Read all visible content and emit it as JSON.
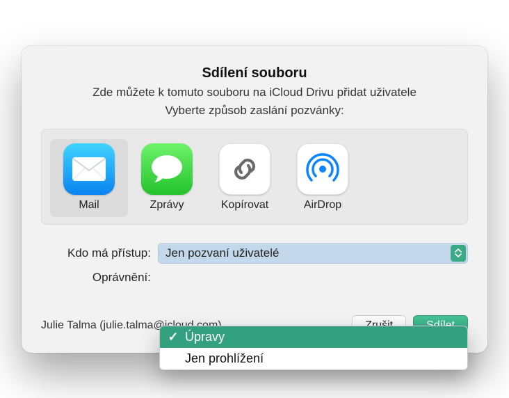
{
  "header": {
    "title": "Sdílení souboru",
    "subtitle": "Zde můžete k tomuto souboru na iCloud Drivu přidat uživatele",
    "prompt": "Vyberte způsob zaslání pozvánky:"
  },
  "methods": {
    "items": [
      {
        "label": "Mail",
        "icon": "mail-icon",
        "selected": true
      },
      {
        "label": "Zprávy",
        "icon": "messages-icon",
        "selected": false
      },
      {
        "label": "Kopírovat",
        "icon": "link-icon",
        "selected": false
      },
      {
        "label": "AirDrop",
        "icon": "airdrop-icon",
        "selected": false
      }
    ]
  },
  "access": {
    "label": "Kdo má přístup:",
    "value": "Jen pozvaní uživatelé"
  },
  "permission": {
    "label": "Oprávnění:",
    "options": [
      {
        "label": "Úpravy",
        "selected": true
      },
      {
        "label": "Jen prohlížení",
        "selected": false
      }
    ]
  },
  "footer": {
    "user": "Julie Talma (julie.talma@icloud.com)",
    "cancel": "Zrušit",
    "share": "Sdílet"
  }
}
